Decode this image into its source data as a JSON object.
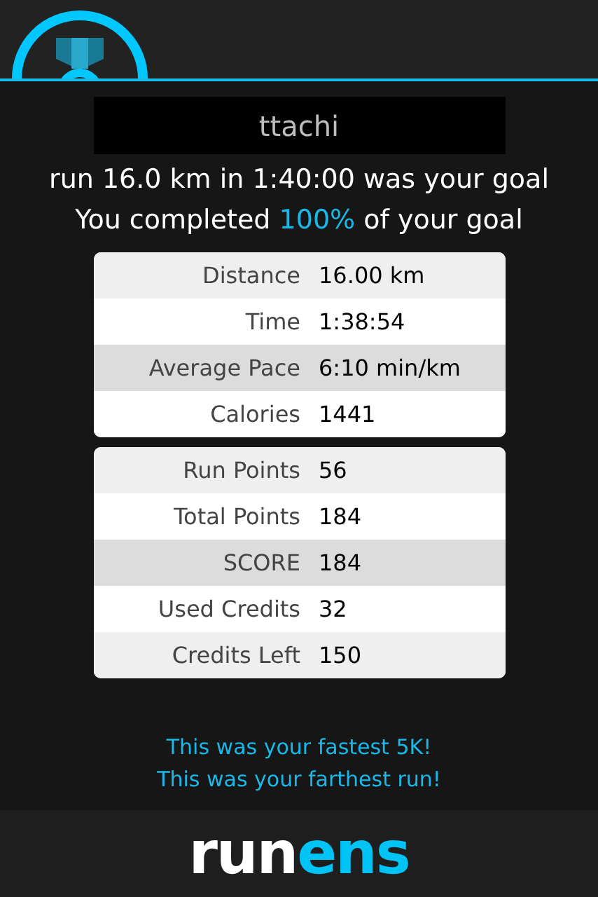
{
  "user_name": "ttachi",
  "goal_text": "run 16.0 km in 1:40:00 was your goal",
  "completion": {
    "prefix": "You completed",
    "percent": "100%",
    "suffix": "of your goal"
  },
  "run_stats": [
    {
      "label": "Distance",
      "value": "16.00 km",
      "highlighted": false
    },
    {
      "label": "Time",
      "value": "1:38:54",
      "highlighted": false
    },
    {
      "label": "Average Pace",
      "value": "6:10 min/km",
      "highlighted": true
    },
    {
      "label": "Calories",
      "value": "1441",
      "highlighted": false
    }
  ],
  "points": [
    {
      "label": "Run Points",
      "value": "56",
      "highlighted": false
    },
    {
      "label": "Total Points",
      "value": "184",
      "highlighted": false
    },
    {
      "label": "SCORE",
      "value": "184",
      "highlighted": true
    },
    {
      "label": "Used Credits",
      "value": "32",
      "highlighted": false
    },
    {
      "label": "Credits Left",
      "value": "150",
      "highlighted": false
    }
  ],
  "achievements": [
    "This was your fastest 5K!",
    "This was your farthest run!"
  ],
  "logo": {
    "part_1": "run",
    "part_2": "ens"
  }
}
